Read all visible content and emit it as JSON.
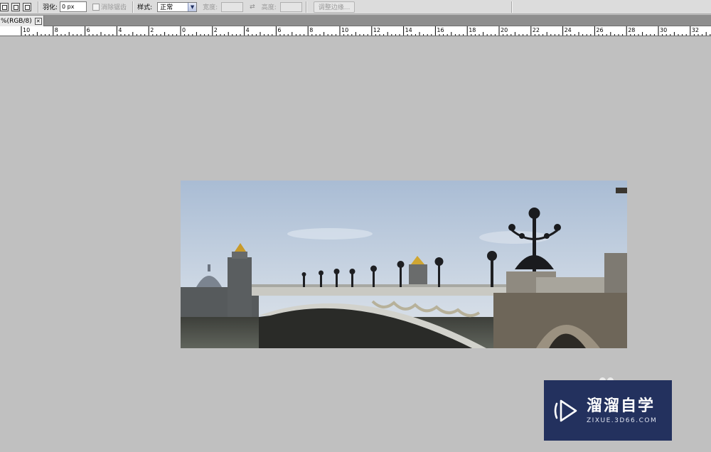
{
  "options_bar": {
    "feather_label": "羽化:",
    "feather_value": "0 px",
    "anti_alias_label": "消除锯齿",
    "style_label": "样式:",
    "style_value": "正常",
    "width_label": "宽度:",
    "height_label": "高度:",
    "refine_edge_label": "调整边缘...",
    "icons": [
      "new-selection-icon",
      "add-selection-icon",
      "subtract-selection-icon",
      "swap-dimensions-icon",
      "dropdown-arrow-icon"
    ]
  },
  "document_tab": {
    "title": "%(RGB/8)",
    "close_icon": "close-icon"
  },
  "ruler": {
    "labels": [
      "10",
      "8",
      "6",
      "4",
      "2",
      "0",
      "2",
      "4",
      "6",
      "8",
      "10",
      "12",
      "14",
      "16",
      "18",
      "20",
      "22",
      "24",
      "26",
      "28",
      "30",
      "32"
    ]
  },
  "canvas": {
    "background_color": "#c0c0c0",
    "image_subject": "bridge-photo"
  },
  "watermark": {
    "title": "溜溜自学",
    "subtitle": "ZIXUE.3D66.COM",
    "background_color": "#23315e",
    "logo_icon": "play-logo-icon"
  }
}
